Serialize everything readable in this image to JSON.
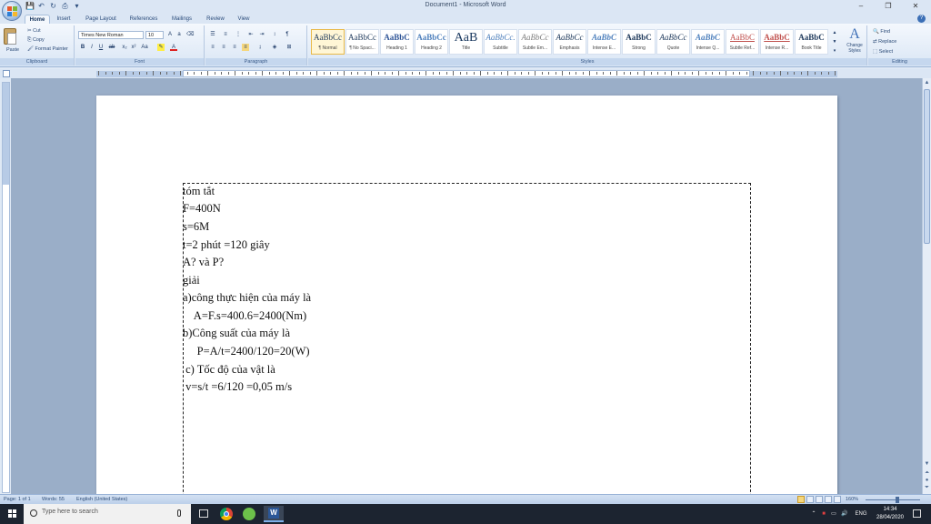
{
  "window": {
    "title": "Document1 - Microsoft Word",
    "minimize": "–",
    "restore": "❐",
    "close": "✕"
  },
  "qat": {
    "save": "💾",
    "undo": "↶",
    "redo": "↻",
    "print": "⎙",
    "dropdown": "▾"
  },
  "tabs": [
    "Home",
    "Insert",
    "Page Layout",
    "References",
    "Mailings",
    "Review",
    "View"
  ],
  "active_tab": "Home",
  "ribbon": {
    "clipboard": {
      "label": "Clipboard",
      "paste": "Paste",
      "cut": "Cut",
      "copy": "Copy",
      "format_painter": "Format Painter"
    },
    "font": {
      "label": "Font",
      "name": "Times New Roman",
      "size": "10"
    },
    "paragraph": {
      "label": "Paragraph"
    },
    "styles": {
      "label": "Styles",
      "items": [
        {
          "sample": "AaBbCc",
          "name": "¶ Normal"
        },
        {
          "sample": "AaBbCc",
          "name": "¶ No Spaci..."
        },
        {
          "sample": "AaBbC",
          "name": "Heading 1"
        },
        {
          "sample": "AaBbCc",
          "name": "Heading 2"
        },
        {
          "sample": "AaB",
          "name": "Title"
        },
        {
          "sample": "AaBbCc.",
          "name": "Subtitle"
        },
        {
          "sample": "AaBbCc",
          "name": "Subtle Em..."
        },
        {
          "sample": "AaBbCc",
          "name": "Emphasis"
        },
        {
          "sample": "AaBbC",
          "name": "Intense E..."
        },
        {
          "sample": "AaBbC",
          "name": "Strong"
        },
        {
          "sample": "AaBbCc",
          "name": "Quote"
        },
        {
          "sample": "AaBbC",
          "name": "Intense Q..."
        },
        {
          "sample": "AaBbC",
          "name": "Subtle Ref..."
        },
        {
          "sample": "AaBbC",
          "name": "Intense R..."
        },
        {
          "sample": "AaBbC",
          "name": "Book Title"
        }
      ],
      "change_styles": "Change Styles"
    },
    "editing": {
      "label": "Editing",
      "find": "Find",
      "replace": "Replace",
      "select": "Select"
    }
  },
  "document": {
    "lines": [
      "tóm tắt",
      "F=400N",
      "s=6M",
      "t=2 phút =120 giây",
      "A? và P?",
      " giải",
      "a)công thực hiện của máy là",
      "    A=F.s=400.6=2400(Nm)",
      "b)Công suất của máy là",
      "     P=A/t=2400/120=20(W)",
      " c) Tốc độ của vật là",
      " v=s/t =6/120 =0,05 m/s"
    ]
  },
  "statusbar": {
    "page": "Page: 1 of 1",
    "words": "Words: 55",
    "language": "English (United States)",
    "zoom": "160%"
  },
  "taskbar": {
    "search_placeholder": "Type here to search",
    "language": "ENG",
    "time": "14:34",
    "date": "28/04/2020"
  }
}
